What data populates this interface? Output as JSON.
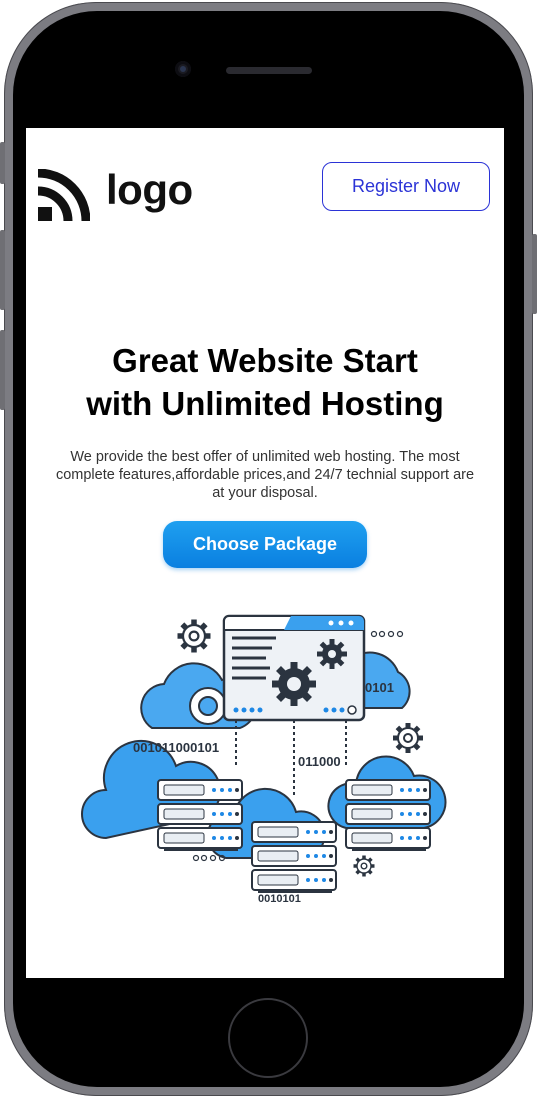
{
  "header": {
    "logo_text": "logo",
    "register_label": "Register Now"
  },
  "hero": {
    "title_line1": "Great Website Start",
    "title_line2": "with Unlimited Hosting",
    "description": "We provide the best offer of unlimited web hosting. The most complete features,affordable prices,and 24/7 technial support are at your disposal.",
    "cta_label": "Choose Package"
  },
  "illustration": {
    "binary_left": "001011000101",
    "binary_right": "0101",
    "binary_center": "011000",
    "binary_bottom": "0010101"
  },
  "colors": {
    "accent": "#0a7fe0",
    "register_border": "#2b33d6",
    "cloud_blue": "#3aa0ee",
    "outline": "#2b3440"
  }
}
